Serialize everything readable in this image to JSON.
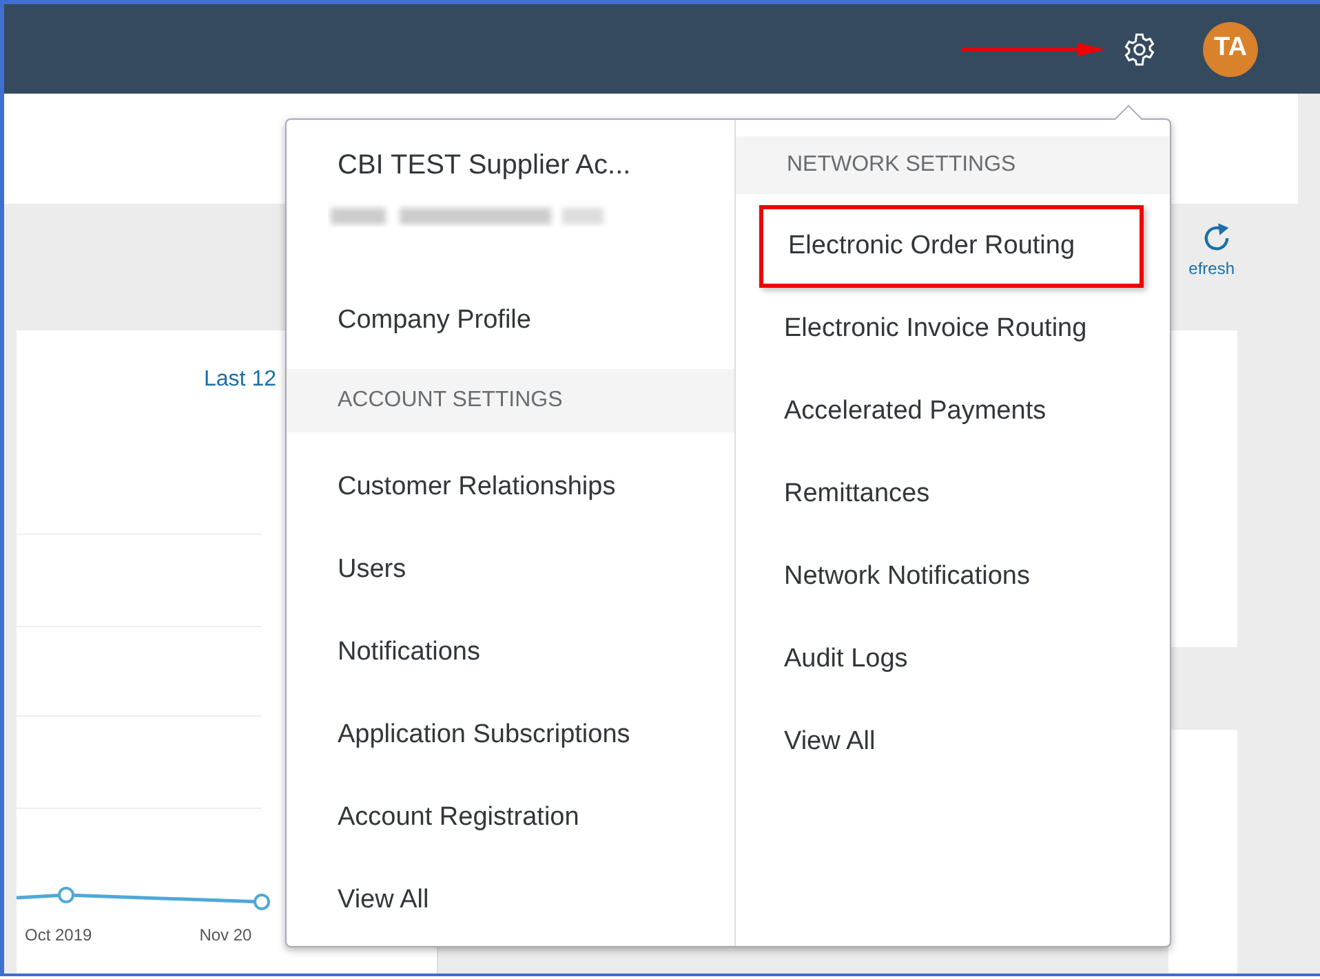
{
  "header": {
    "avatar_initials": "TA"
  },
  "background": {
    "period_link": "Last 12",
    "refresh_label": "efresh",
    "chart_labels": [
      "Oct 2019",
      "Nov 20"
    ]
  },
  "menu": {
    "account_name": "CBI TEST Supplier Ac...",
    "left": [
      {
        "kind": "item",
        "label": "Company Profile",
        "highlighted": false
      },
      {
        "kind": "header",
        "label": "ACCOUNT SETTINGS",
        "highlighted": false
      },
      {
        "kind": "item",
        "label": "Customer Relationships",
        "highlighted": false
      },
      {
        "kind": "item",
        "label": "Users",
        "highlighted": false
      },
      {
        "kind": "item",
        "label": "Notifications",
        "highlighted": false
      },
      {
        "kind": "item",
        "label": "Application Subscriptions",
        "highlighted": false
      },
      {
        "kind": "item",
        "label": "Account Registration",
        "highlighted": false
      },
      {
        "kind": "item",
        "label": "View All",
        "highlighted": false
      }
    ],
    "right": [
      {
        "kind": "header",
        "label": "NETWORK SETTINGS",
        "highlighted": false
      },
      {
        "kind": "item",
        "label": "Electronic Order Routing",
        "highlighted": true
      },
      {
        "kind": "item",
        "label": "Electronic Invoice Routing",
        "highlighted": false
      },
      {
        "kind": "item",
        "label": "Accelerated Payments",
        "highlighted": false
      },
      {
        "kind": "item",
        "label": "Remittances",
        "highlighted": false
      },
      {
        "kind": "item",
        "label": "Network Notifications",
        "highlighted": false
      },
      {
        "kind": "item",
        "label": "Audit Logs",
        "highlighted": false
      },
      {
        "kind": "item",
        "label": "View All",
        "highlighted": false
      }
    ]
  }
}
